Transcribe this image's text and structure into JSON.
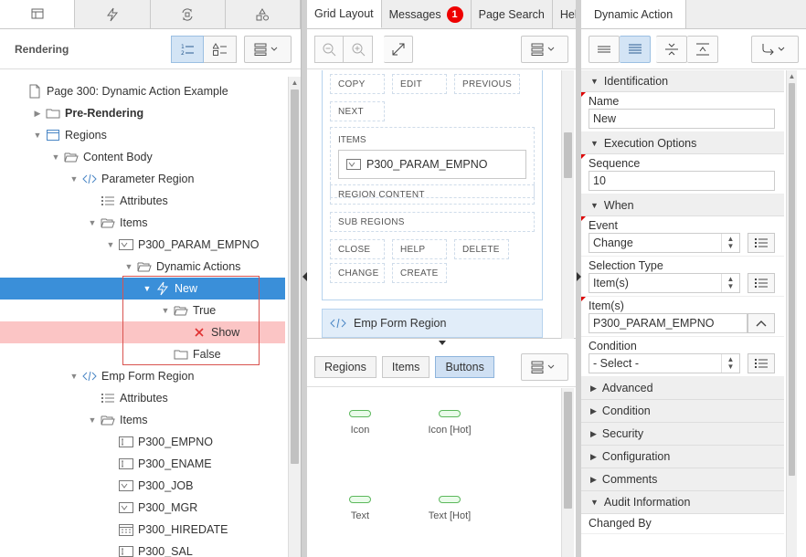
{
  "left": {
    "tabs": [
      "rendering-icon",
      "dynamic-action-icon",
      "processing-icon",
      "shared-components-icon"
    ],
    "header_title": "Rendering",
    "tree": [
      {
        "label": "Page 300: Dynamic Action Example",
        "icon": "page-icon",
        "indent": 0,
        "toggle": ""
      },
      {
        "label": "Pre-Rendering",
        "icon": "folder-icon",
        "indent": 1,
        "toggle": "▶",
        "bold": true
      },
      {
        "label": "Regions",
        "icon": "region-icon",
        "indent": 1,
        "toggle": "▼"
      },
      {
        "label": "Content Body",
        "icon": "folder-open-icon",
        "indent": 2,
        "toggle": "▼"
      },
      {
        "label": "Parameter Region",
        "icon": "code-icon",
        "indent": 3,
        "toggle": "▼"
      },
      {
        "label": "Attributes",
        "icon": "list-icon",
        "indent": 4,
        "toggle": ""
      },
      {
        "label": "Items",
        "icon": "folder-open-icon",
        "indent": 4,
        "toggle": "▼"
      },
      {
        "label": "P300_PARAM_EMPNO",
        "icon": "select-item-icon",
        "indent": 5,
        "toggle": "▼"
      },
      {
        "label": "Dynamic Actions",
        "icon": "folder-open-icon",
        "indent": 6,
        "toggle": "▼"
      },
      {
        "label": "New",
        "icon": "lightning-icon",
        "indent": 7,
        "toggle": "▼",
        "state": "selected"
      },
      {
        "label": "True",
        "icon": "folder-open-icon",
        "indent": 8,
        "toggle": "▼"
      },
      {
        "label": "Show",
        "icon": "error-x-icon",
        "indent": 9,
        "toggle": "",
        "state": "error"
      },
      {
        "label": "False",
        "icon": "folder-icon",
        "indent": 8,
        "toggle": ""
      },
      {
        "label": "Emp Form Region",
        "icon": "code-icon",
        "indent": 3,
        "toggle": "▼"
      },
      {
        "label": "Attributes",
        "icon": "list-icon",
        "indent": 4,
        "toggle": ""
      },
      {
        "label": "Items",
        "icon": "folder-open-icon",
        "indent": 4,
        "toggle": "▼"
      },
      {
        "label": "P300_EMPNO",
        "icon": "text-item-icon",
        "indent": 5,
        "toggle": ""
      },
      {
        "label": "P300_ENAME",
        "icon": "text-item-icon",
        "indent": 5,
        "toggle": ""
      },
      {
        "label": "P300_JOB",
        "icon": "select-item-icon",
        "indent": 5,
        "toggle": ""
      },
      {
        "label": "P300_MGR",
        "icon": "select-item-icon",
        "indent": 5,
        "toggle": ""
      },
      {
        "label": "P300_HIREDATE",
        "icon": "date-item-icon",
        "indent": 5,
        "toggle": ""
      },
      {
        "label": "P300_SAL",
        "icon": "text-item-icon",
        "indent": 5,
        "toggle": ""
      }
    ]
  },
  "middle": {
    "tabs": [
      {
        "label": "Grid Layout",
        "active": true
      },
      {
        "label": "Messages",
        "badge": "1"
      },
      {
        "label": "Page Search"
      },
      {
        "label": "Hel"
      }
    ],
    "grid": {
      "positions_row1": [
        "COPY",
        "EDIT",
        "PREVIOUS"
      ],
      "positions_row2": [
        "NEXT"
      ],
      "items_label": "ITEMS",
      "item_name": "P300_PARAM_EMPNO",
      "region_content": "REGION CONTENT",
      "sub_regions": "SUB REGIONS",
      "positions_row3": [
        "CLOSE",
        "HELP",
        "DELETE"
      ],
      "positions_row4": [
        "CHANGE",
        "CREATE"
      ],
      "emp_region": "Emp Form Region"
    },
    "gallery_tabs": [
      {
        "label": "Regions"
      },
      {
        "label": "Items"
      },
      {
        "label": "Buttons",
        "active": true
      }
    ],
    "gallery_items": [
      "Icon",
      "Icon [Hot]",
      "Text",
      "Text [Hot]"
    ]
  },
  "right": {
    "tab": "Dynamic Action",
    "sections": {
      "identification": "Identification",
      "execution": "Execution Options",
      "when": "When",
      "advanced": "Advanced",
      "condition": "Condition",
      "security": "Security",
      "configuration": "Configuration",
      "comments": "Comments",
      "audit": "Audit Information"
    },
    "fields": {
      "name_label": "Name",
      "name_value": "New",
      "sequence_label": "Sequence",
      "sequence_value": "10",
      "event_label": "Event",
      "event_value": "Change",
      "selection_type_label": "Selection Type",
      "selection_type_value": "Item(s)",
      "items_label": "Item(s)",
      "items_value": "P300_PARAM_EMPNO",
      "condition_label": "Condition",
      "condition_value": "- Select -",
      "changed_by_label": "Changed By"
    }
  },
  "colors": {
    "selected": "#3a8fd9",
    "error_row": "#fbc5c5",
    "badge": "#e00000",
    "active_btn": "#d3e4f5"
  }
}
